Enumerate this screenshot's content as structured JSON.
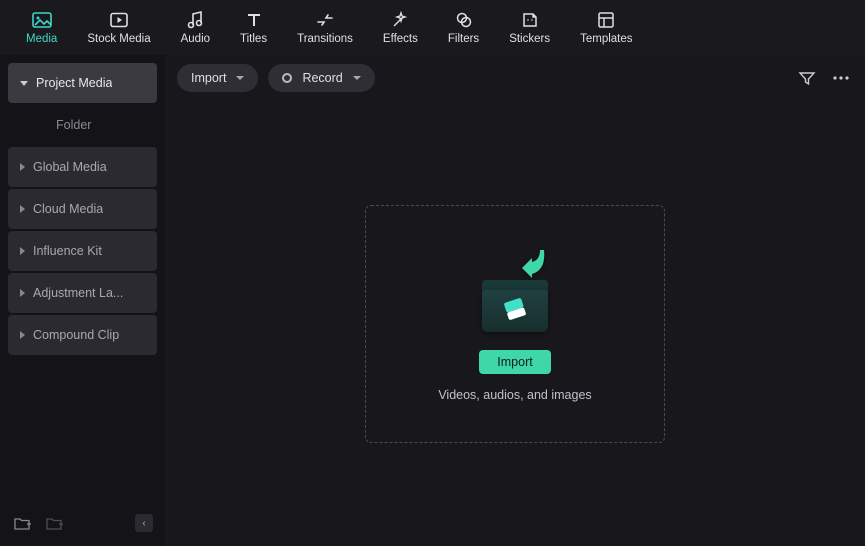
{
  "topbar": {
    "items": [
      {
        "label": "Media",
        "active": true
      },
      {
        "label": "Stock Media",
        "active": false
      },
      {
        "label": "Audio",
        "active": false
      },
      {
        "label": "Titles",
        "active": false
      },
      {
        "label": "Transitions",
        "active": false
      },
      {
        "label": "Effects",
        "active": false
      },
      {
        "label": "Filters",
        "active": false
      },
      {
        "label": "Stickers",
        "active": false
      },
      {
        "label": "Templates",
        "active": false
      }
    ]
  },
  "sidebar": {
    "items": [
      {
        "label": "Project Media",
        "expanded": true
      },
      {
        "label": "Global Media",
        "expanded": false
      },
      {
        "label": "Cloud Media",
        "expanded": false
      },
      {
        "label": "Influence Kit",
        "expanded": false
      },
      {
        "label": "Adjustment La...",
        "expanded": false
      },
      {
        "label": "Compound Clip",
        "expanded": false
      }
    ],
    "sub": {
      "label": "Folder"
    }
  },
  "contentbar": {
    "import_label": "Import",
    "record_label": "Record"
  },
  "dropzone": {
    "button_label": "Import",
    "hint": "Videos, audios, and images"
  }
}
